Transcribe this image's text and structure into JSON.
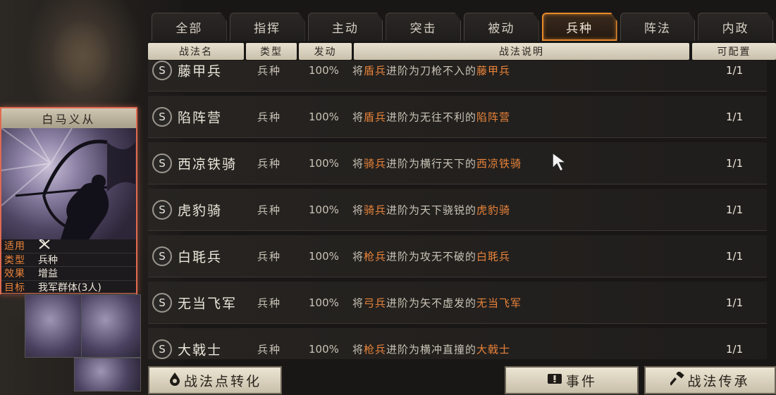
{
  "tabs": [
    {
      "label": "全部"
    },
    {
      "label": "指挥"
    },
    {
      "label": "主动"
    },
    {
      "label": "突击"
    },
    {
      "label": "被动"
    },
    {
      "label": "兵种",
      "active": true
    },
    {
      "label": "阵法"
    },
    {
      "label": "内政"
    }
  ],
  "table_headers": {
    "name": "战法名",
    "type": "类型",
    "rate": "发动",
    "desc": "战法说明",
    "config": "可配置"
  },
  "rows": [
    {
      "badge": "S",
      "name": "藤甲兵",
      "type": "兵种",
      "rate": "100%",
      "desc": [
        "将",
        "盾兵",
        "进阶为刀枪不入的",
        "藤甲兵",
        ""
      ],
      "config": "1/1"
    },
    {
      "badge": "S",
      "name": "陷阵营",
      "type": "兵种",
      "rate": "100%",
      "desc": [
        "将",
        "盾兵",
        "进阶为无往不利的",
        "陷阵营",
        ""
      ],
      "config": "1/1"
    },
    {
      "badge": "S",
      "name": "西凉铁骑",
      "type": "兵种",
      "rate": "100%",
      "desc": [
        "将",
        "骑兵",
        "进阶为横行天下的",
        "西凉铁骑",
        ""
      ],
      "config": "1/1"
    },
    {
      "badge": "S",
      "name": "虎豹骑",
      "type": "兵种",
      "rate": "100%",
      "desc": [
        "将",
        "骑兵",
        "进阶为天下骁锐的",
        "虎豹骑",
        ""
      ],
      "config": "1/1"
    },
    {
      "badge": "S",
      "name": "白毦兵",
      "type": "兵种",
      "rate": "100%",
      "desc": [
        "将",
        "枪兵",
        "进阶为攻无不破的",
        "白毦兵",
        ""
      ],
      "config": "1/1"
    },
    {
      "badge": "S",
      "name": "无当飞军",
      "type": "兵种",
      "rate": "100%",
      "desc": [
        "将",
        "弓兵",
        "进阶为矢不虚发的",
        "无当飞军",
        ""
      ],
      "config": "1/1"
    },
    {
      "badge": "S",
      "name": "大戟士",
      "type": "兵种",
      "rate": "100%",
      "desc": [
        "将",
        "枪兵",
        "进阶为横冲直撞的",
        "大戟士",
        ""
      ],
      "config": "1/1"
    }
  ],
  "card": {
    "title": "白马义从",
    "info": [
      {
        "key": "适用",
        "value": "",
        "icon": "crossed-weapons-icon"
      },
      {
        "key": "类型",
        "value": "兵种"
      },
      {
        "key": "效果",
        "value": "增益"
      },
      {
        "key": "目标",
        "value": "我军群体(3人)"
      }
    ]
  },
  "buttons": {
    "convert": {
      "label": "战法点转化",
      "icon": "fire-drop-icon"
    },
    "event": {
      "label": "事件",
      "icon": "alert-scroll-icon"
    },
    "inherit": {
      "label": "战法传承",
      "icon": "hammer-icon"
    }
  },
  "colors": {
    "accent": "#e88a2b",
    "highlight_text": "#e8833a",
    "card_border": "#e06a50"
  }
}
